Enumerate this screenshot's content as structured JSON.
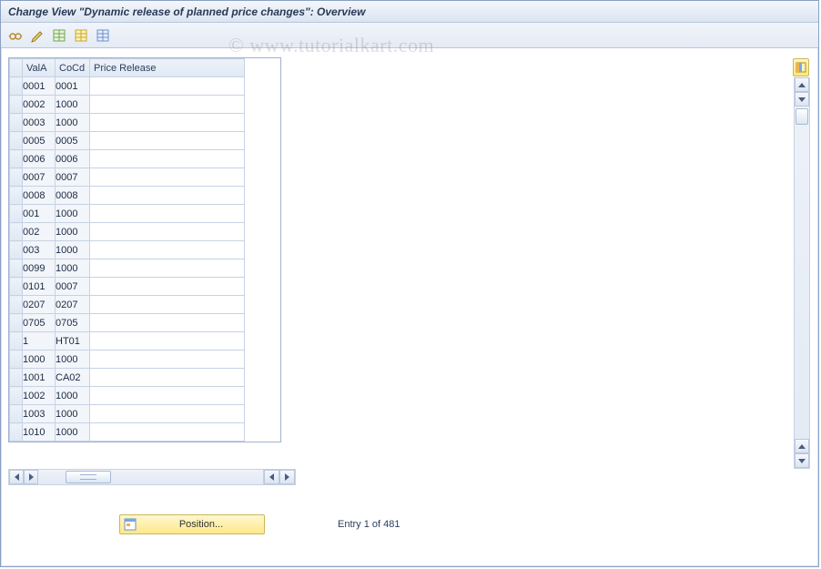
{
  "title": "Change View \"Dynamic release of planned price changes\": Overview",
  "watermark": "© www.tutorialkart.com",
  "toolbar": {
    "icons": [
      "other-view",
      "change-display",
      "select-all",
      "save",
      "deselect-all"
    ]
  },
  "grid": {
    "columns": [
      "ValA",
      "CoCd",
      "Price Release"
    ],
    "rows": [
      {
        "vala": "0001",
        "cocd": "0001",
        "price": ""
      },
      {
        "vala": "0002",
        "cocd": "1000",
        "price": ""
      },
      {
        "vala": "0003",
        "cocd": "1000",
        "price": ""
      },
      {
        "vala": "0005",
        "cocd": "0005",
        "price": ""
      },
      {
        "vala": "0006",
        "cocd": "0006",
        "price": ""
      },
      {
        "vala": "0007",
        "cocd": "0007",
        "price": ""
      },
      {
        "vala": "0008",
        "cocd": "0008",
        "price": ""
      },
      {
        "vala": "001",
        "cocd": "1000",
        "price": ""
      },
      {
        "vala": "002",
        "cocd": "1000",
        "price": ""
      },
      {
        "vala": "003",
        "cocd": "1000",
        "price": ""
      },
      {
        "vala": "0099",
        "cocd": "1000",
        "price": ""
      },
      {
        "vala": "0101",
        "cocd": "0007",
        "price": ""
      },
      {
        "vala": "0207",
        "cocd": "0207",
        "price": ""
      },
      {
        "vala": "0705",
        "cocd": "0705",
        "price": ""
      },
      {
        "vala": "1",
        "cocd": "HT01",
        "price": ""
      },
      {
        "vala": "1000",
        "cocd": "1000",
        "price": ""
      },
      {
        "vala": "1001",
        "cocd": "CA02",
        "price": ""
      },
      {
        "vala": "1002",
        "cocd": "1000",
        "price": ""
      },
      {
        "vala": "1003",
        "cocd": "1000",
        "price": ""
      },
      {
        "vala": "1010",
        "cocd": "1000",
        "price": ""
      }
    ]
  },
  "footer": {
    "position_label": "Position...",
    "entry_text": "Entry 1 of 481"
  }
}
